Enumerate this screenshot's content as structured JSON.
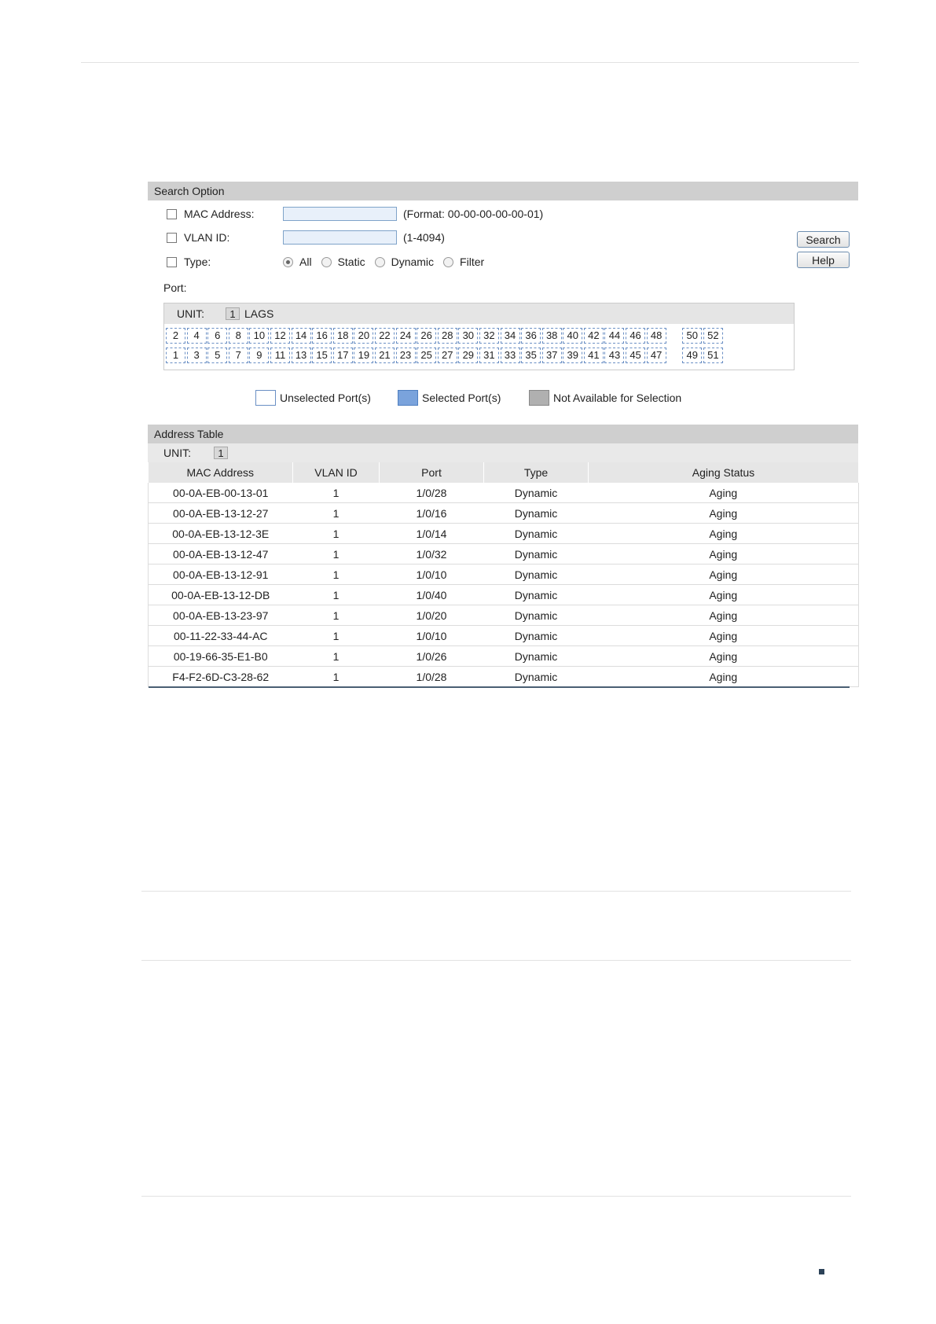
{
  "search_option": {
    "header": "Search Option",
    "mac_address": {
      "label": "MAC Address:",
      "value": "",
      "hint": "(Format: 00-00-00-00-00-01)"
    },
    "vlan_id": {
      "label": "VLAN ID:",
      "value": "",
      "hint": "(1-4094)"
    },
    "type": {
      "label": "Type:",
      "options": [
        "All",
        "Static",
        "Dynamic",
        "Filter"
      ],
      "selected": "All"
    },
    "search_button": "Search",
    "help_button": "Help",
    "port": {
      "label": "Port:",
      "unit_label": "UNIT:",
      "unit_value": "1",
      "lags_label": "LAGS",
      "even_ports": [
        "2",
        "4",
        "6",
        "8",
        "10",
        "12",
        "14",
        "16",
        "18",
        "20",
        "22",
        "24",
        "26",
        "28",
        "30",
        "32",
        "34",
        "36",
        "38",
        "40",
        "42",
        "44",
        "46",
        "48"
      ],
      "odd_ports": [
        "1",
        "3",
        "5",
        "7",
        "9",
        "11",
        "13",
        "15",
        "17",
        "19",
        "21",
        "23",
        "25",
        "27",
        "29",
        "31",
        "33",
        "35",
        "37",
        "39",
        "41",
        "43",
        "45",
        "47"
      ],
      "extra_even": [
        "50",
        "52"
      ],
      "extra_odd": [
        "49",
        "51"
      ]
    },
    "legend": {
      "unselected": "Unselected Port(s)",
      "selected": "Selected Port(s)",
      "not_available": "Not Available for Selection"
    }
  },
  "address_table": {
    "header": "Address Table",
    "unit_label": "UNIT:",
    "unit_value": "1",
    "columns": [
      "MAC Address",
      "VLAN ID",
      "Port",
      "Type",
      "Aging Status"
    ],
    "rows": [
      [
        "00-0A-EB-00-13-01",
        "1",
        "1/0/28",
        "Dynamic",
        "Aging"
      ],
      [
        "00-0A-EB-13-12-27",
        "1",
        "1/0/16",
        "Dynamic",
        "Aging"
      ],
      [
        "00-0A-EB-13-12-3E",
        "1",
        "1/0/14",
        "Dynamic",
        "Aging"
      ],
      [
        "00-0A-EB-13-12-47",
        "1",
        "1/0/32",
        "Dynamic",
        "Aging"
      ],
      [
        "00-0A-EB-13-12-91",
        "1",
        "1/0/10",
        "Dynamic",
        "Aging"
      ],
      [
        "00-0A-EB-13-12-DB",
        "1",
        "1/0/40",
        "Dynamic",
        "Aging"
      ],
      [
        "00-0A-EB-13-23-97",
        "1",
        "1/0/20",
        "Dynamic",
        "Aging"
      ],
      [
        "00-11-22-33-44-AC",
        "1",
        "1/0/10",
        "Dynamic",
        "Aging"
      ],
      [
        "00-19-66-35-E1-B0",
        "1",
        "1/0/26",
        "Dynamic",
        "Aging"
      ],
      [
        "F4-F2-6D-C3-28-62",
        "1",
        "1/0/28",
        "Dynamic",
        "Aging"
      ]
    ]
  }
}
